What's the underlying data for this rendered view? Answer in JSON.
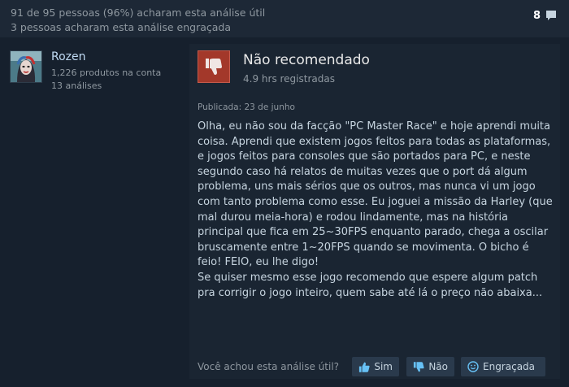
{
  "header": {
    "helpful_text": "91 de 95 pessoas (96%) acharam esta análise útil",
    "funny_text": "3 pessoas acharam esta análise engraçada",
    "comment_count": "8"
  },
  "author": {
    "name": "Rozen",
    "products": "1,226 produtos na conta",
    "reviews": "13 análises"
  },
  "review": {
    "recommendation": "Não recomendado",
    "hours": "4.9 hrs registradas",
    "posted": "Publicada: 23 de junho",
    "paragraph1": "Olha, eu não sou da facção \"PC Master Race\" e hoje aprendi muita coisa. Aprendi que existem jogos feitos para todas as plataformas, e jogos feitos para consoles que são portados para PC, e neste segundo caso há relatos de muitas vezes que o port dá algum problema, uns mais sérios que os outros, mas nunca vi um jogo com tanto problema como esse. Eu joguei a missão da Harley (que mal durou meia-hora) e rodou lindamente, mas na história principal que fica em 25~30FPS enquanto parado, chega a oscilar bruscamente entre 1~20FPS quando se movimenta. O bicho é feio! FEIO, eu lhe digo!",
    "paragraph2": "Se quiser mesmo esse jogo recomendo que espere algum patch pra corrigir o jogo inteiro, quem sabe até lá o preço não abaixa..."
  },
  "footer": {
    "question": "Você achou esta análise útil?",
    "yes_label": "Sim",
    "no_label": "Não",
    "funny_label": "Engraçada"
  },
  "colors": {
    "background": "#16202d",
    "thumb_down": "#a3382a",
    "button": "#2a3a4c",
    "link_blue": "#c1dbf4"
  }
}
